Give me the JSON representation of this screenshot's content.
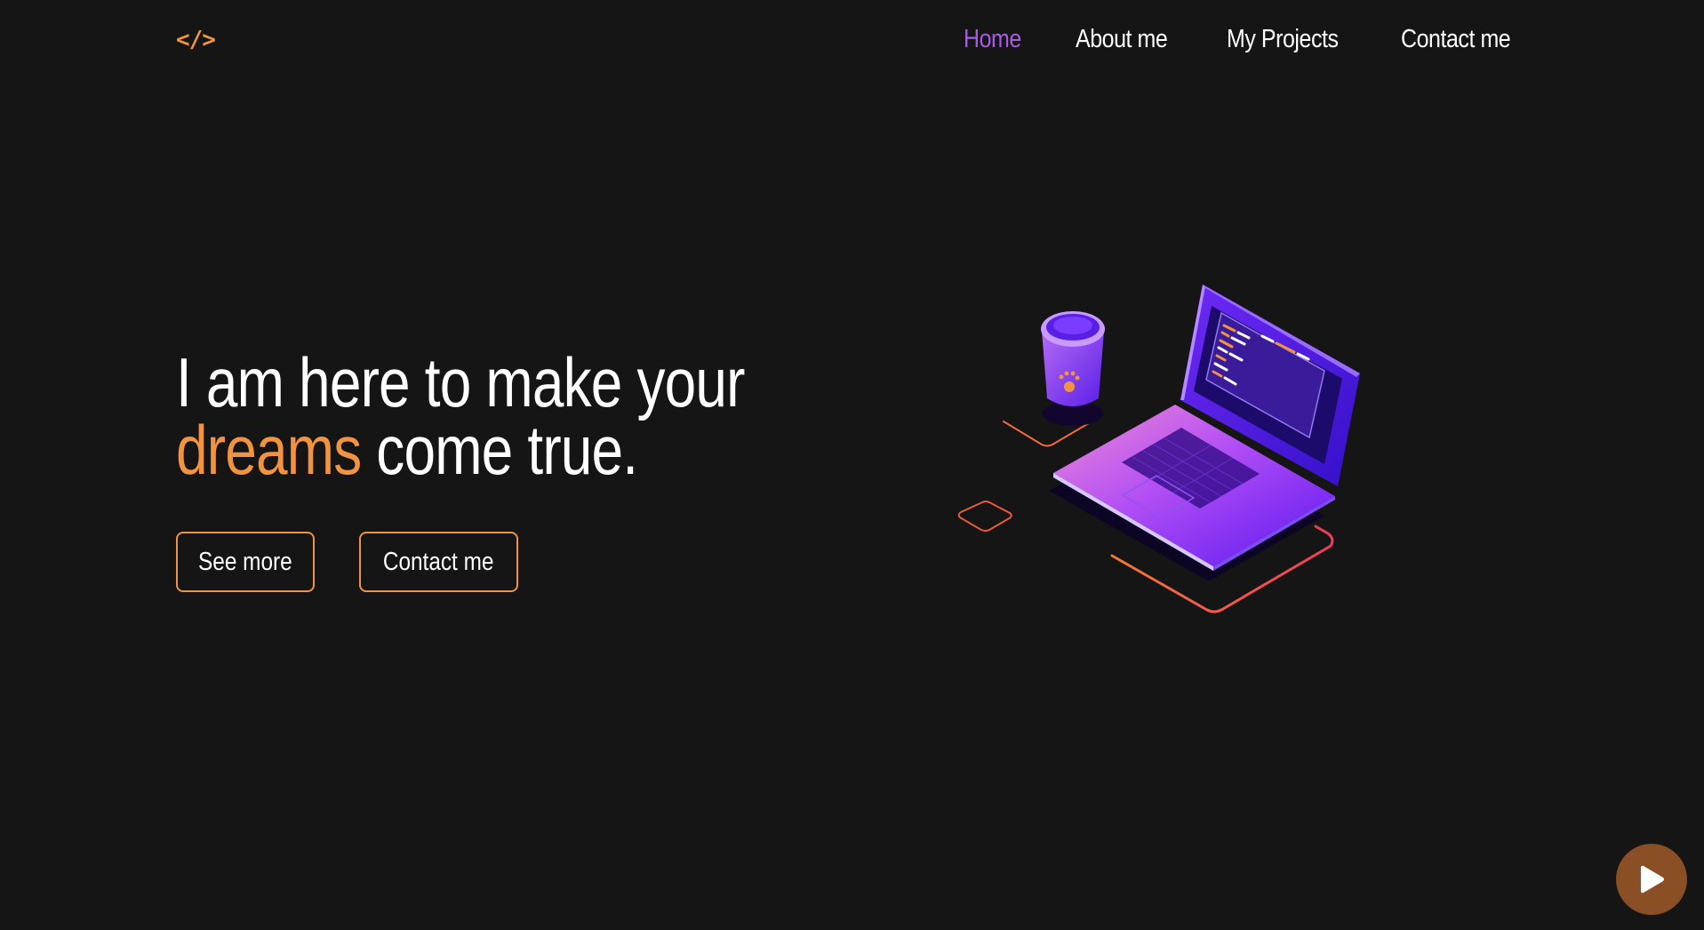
{
  "header": {
    "logo_text": "</>",
    "nav": [
      {
        "label": "Home",
        "active": true
      },
      {
        "label": "About me",
        "active": false
      },
      {
        "label": "My Projects",
        "active": false
      },
      {
        "label": "Contact me",
        "active": false
      }
    ]
  },
  "hero": {
    "title_line1": "I am here to make your",
    "title_accent": "dreams",
    "title_line2_rest": " come true.",
    "buttons": {
      "see_more": "See more",
      "contact": "Contact me"
    },
    "illustration_icon": "laptop-coffee-illustration"
  },
  "player": {
    "icon": "play-icon"
  },
  "colors": {
    "background": "#151515",
    "accent_orange": "#f29340",
    "active_purple": "#a95be8",
    "play_button": "#8a4f24"
  }
}
